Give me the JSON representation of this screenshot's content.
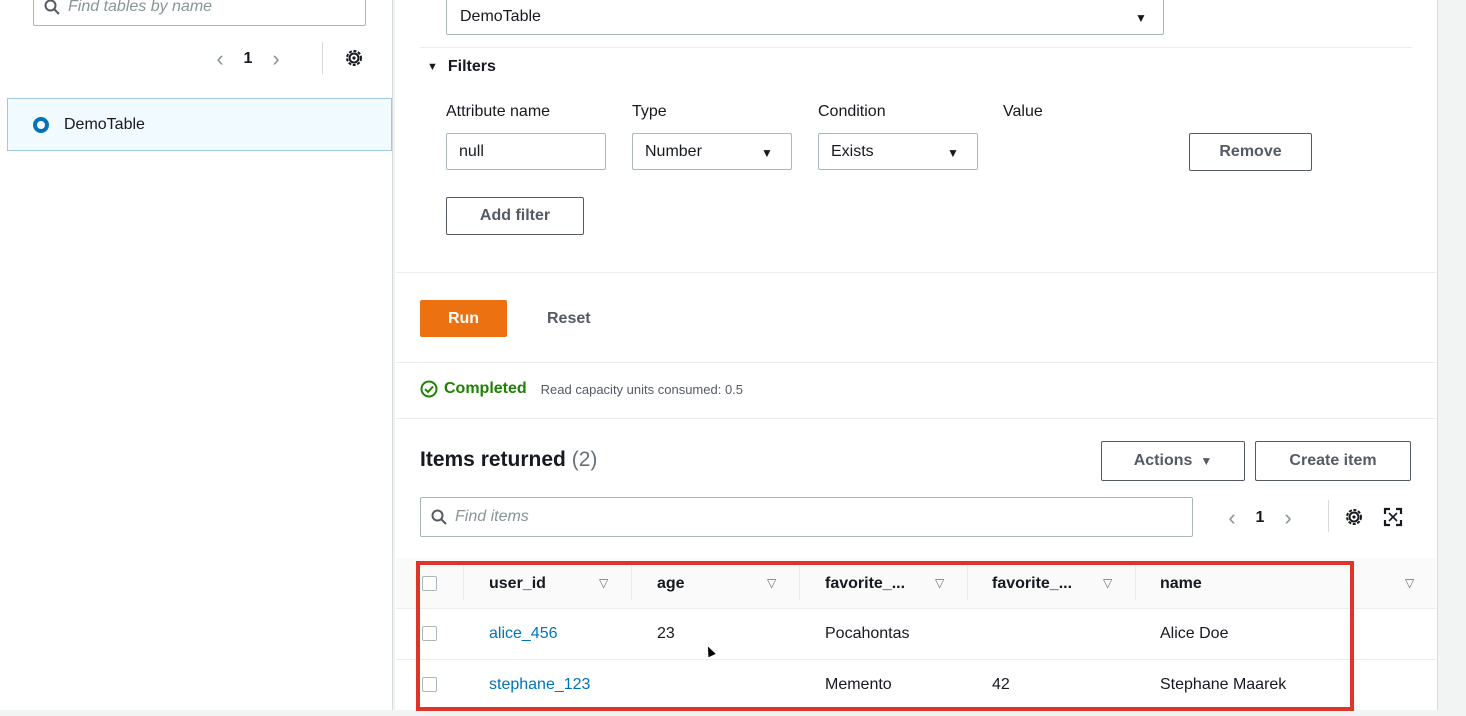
{
  "sidebar": {
    "search_placeholder": "Find tables by name",
    "page": "1",
    "tables": [
      {
        "label": "DemoTable",
        "selected": true
      }
    ]
  },
  "query": {
    "table_value": "DemoTable",
    "filters_label": "Filters",
    "columns": {
      "attribute": "Attribute name",
      "type": "Type",
      "condition": "Condition",
      "value": "Value"
    },
    "filter": {
      "attribute": "null",
      "type": "Number",
      "condition": "Exists"
    },
    "remove_label": "Remove",
    "add_filter_label": "Add filter",
    "run_label": "Run",
    "reset_label": "Reset"
  },
  "status": {
    "text": "Completed",
    "detail": "Read capacity units consumed: 0.5",
    "color": "#1d8102"
  },
  "results": {
    "title": "Items returned",
    "count": "(2)",
    "actions_label": "Actions",
    "create_label": "Create item",
    "search_placeholder": "Find items",
    "page": "1",
    "headers": [
      "user_id",
      "age",
      "favorite_...",
      "favorite_...",
      "name"
    ],
    "rows": [
      {
        "user_id": "alice_456",
        "age": "23",
        "fav1": "Pocahontas",
        "fav2": "",
        "name": "Alice Doe"
      },
      {
        "user_id": "stephane_123",
        "age": "",
        "fav1": "Memento",
        "fav2": "42",
        "name": "Stephane Maarek"
      }
    ]
  },
  "colors": {
    "accent": "#ec7211",
    "link": "#0073bb",
    "highlight": "#e0342a"
  }
}
